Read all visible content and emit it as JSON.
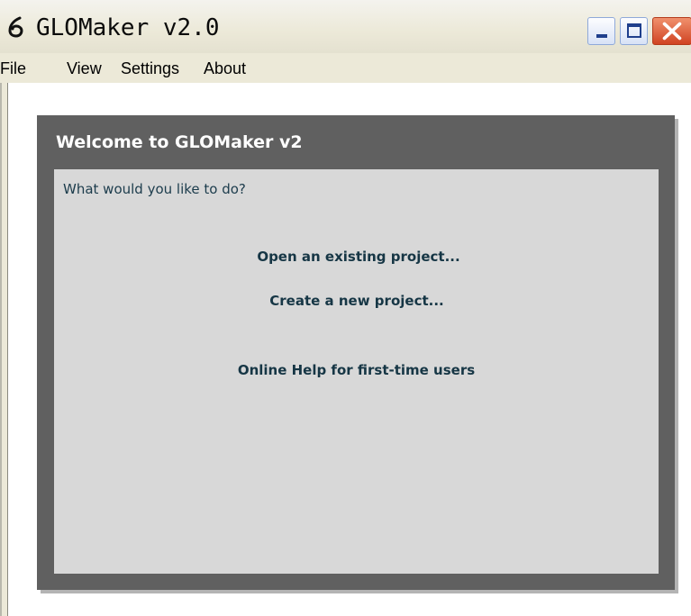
{
  "window": {
    "title": "GLOMaker v2.0",
    "app_icon": "glomaker-logo-icon"
  },
  "caption_buttons": {
    "minimize": "minimize-icon",
    "maximize": "maximize-icon",
    "close": "close-icon"
  },
  "menu": {
    "items": [
      {
        "label": "File"
      },
      {
        "label": "View"
      },
      {
        "label": "Settings"
      },
      {
        "label": "About"
      }
    ]
  },
  "welcome": {
    "title": "Welcome to GLOMaker v2",
    "prompt": "What would you like to do?",
    "actions": [
      {
        "label": "Open an existing project..."
      },
      {
        "label": "Create a new project..."
      },
      {
        "label": "Online Help for first-time users"
      }
    ]
  },
  "colors": {
    "panel_dark": "#606060",
    "content_bg": "#d8d8d8",
    "link_text": "#163645",
    "close_button": "#d04322",
    "menubar_bg": "#ece9d8"
  }
}
